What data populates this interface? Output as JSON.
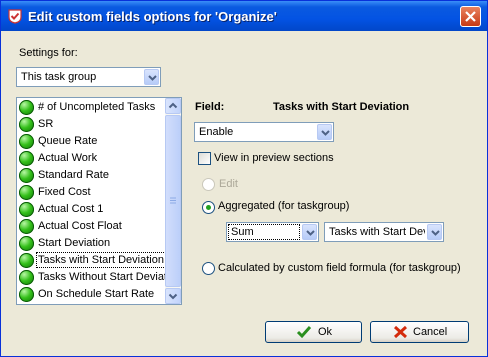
{
  "window": {
    "title": "Edit custom fields options for  'Organize'",
    "icons": {
      "app": "app-check-icon",
      "close": "close-icon"
    }
  },
  "settings": {
    "label": "Settings for:",
    "selected": "This task group"
  },
  "fields_list": {
    "items": [
      {
        "label": "# of Uncompleted Tasks",
        "icon": "green-status-icon"
      },
      {
        "label": "SR",
        "icon": "green-status-icon"
      },
      {
        "label": "Queue Rate",
        "icon": "green-status-icon"
      },
      {
        "label": "Actual Work",
        "icon": "green-status-icon"
      },
      {
        "label": "Standard Rate",
        "icon": "green-status-icon"
      },
      {
        "label": "Fixed Cost",
        "icon": "green-status-icon"
      },
      {
        "label": "Actual Cost 1",
        "icon": "green-status-icon"
      },
      {
        "label": "Actual Cost Float",
        "icon": "green-status-icon"
      },
      {
        "label": "Start Deviation",
        "icon": "green-status-icon"
      },
      {
        "label": "Tasks with Start Deviation",
        "icon": "green-status-icon",
        "selected": true
      },
      {
        "label": "Tasks Without Start Deviation",
        "icon": "green-status-icon"
      },
      {
        "label": "On Schedule Start Rate",
        "icon": "green-status-icon"
      }
    ]
  },
  "field": {
    "label": "Field:",
    "name": "Tasks with Start Deviation",
    "mode_selected": "Enable",
    "view_in_preview": {
      "label": "View in preview sections",
      "checked": false
    },
    "edit_option": {
      "label": "Edit",
      "enabled": false,
      "selected": false
    },
    "aggregated_option": {
      "label": "Aggregated (for taskgroup)",
      "selected": true
    },
    "aggregate_function": "Sum",
    "aggregate_source": "Tasks with Start Deviation",
    "formula_option": {
      "label": "Calculated by custom field formula (for taskgroup)",
      "selected": false
    }
  },
  "buttons": {
    "ok": "Ok",
    "cancel": "Cancel"
  },
  "colors": {
    "title_bar": "#0353e3",
    "dialog_bg": "#ece9d8",
    "radio_selected": "#21a121",
    "status_green": "#34c01a",
    "cancel_icon": "#d42b0c"
  }
}
